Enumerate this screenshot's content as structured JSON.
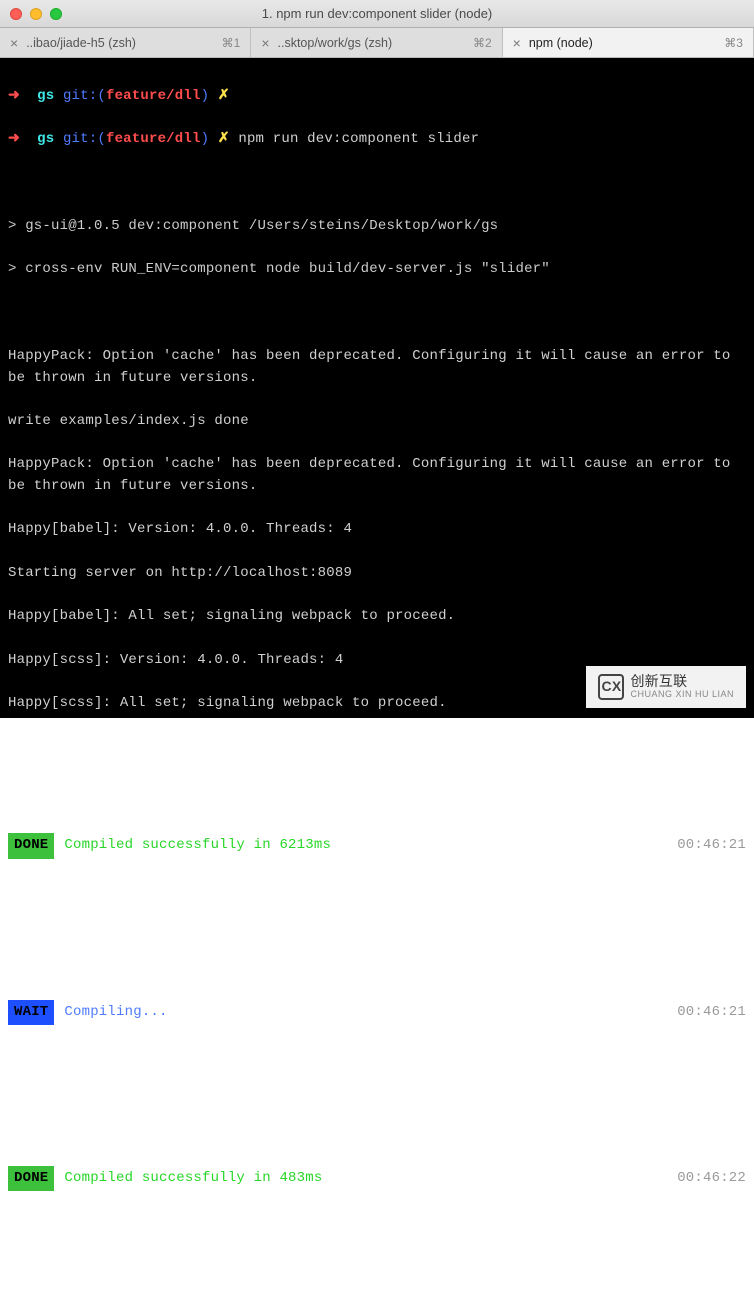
{
  "window": {
    "title": "1. npm run dev:component slider (node)"
  },
  "tabs": [
    {
      "label": "..ibao/jiade-h5 (zsh)",
      "shortcut": "⌘1",
      "active": false
    },
    {
      "label": "..sktop/work/gs (zsh)",
      "shortcut": "⌘2",
      "active": false
    },
    {
      "label": "npm (node)",
      "shortcut": "⌘3",
      "active": true
    }
  ],
  "prompt": {
    "arrow": "➜",
    "dir": "gs",
    "git_prefix": "git:(",
    "branch": "feature/dll",
    "git_suffix": ")",
    "dirty": "✗",
    "command": "npm run dev:component slider"
  },
  "output": {
    "line1": "> gs-ui@1.0.5 dev:component /Users/steins/Desktop/work/gs",
    "line2": "> cross-env RUN_ENV=component node build/dev-server.js \"slider\"",
    "hp1": "HappyPack: Option 'cache' has been deprecated. Configuring it will cause an error to be thrown in future versions.",
    "write": "write examples/index.js done",
    "hp2": "HappyPack: Option 'cache' has been deprecated. Configuring it will cause an error to be thrown in future versions.",
    "babel_ver": "Happy[babel]: Version: 4.0.0. Threads: 4",
    "server": "Starting server on http://localhost:8089",
    "babel_set": "Happy[babel]: All set; signaling webpack to proceed.",
    "scss_ver": "Happy[scss]: Version: 4.0.0. Threads: 4",
    "scss_set": "Happy[scss]: All set; signaling webpack to proceed."
  },
  "status": [
    {
      "badge": "DONE",
      "type": "done",
      "msg": "Compiled successfully in 6213ms",
      "time": "00:46:21"
    },
    {
      "badge": "WAIT",
      "type": "wait",
      "msg": "Compiling...",
      "time": "00:46:21"
    },
    {
      "badge": "DONE",
      "type": "done",
      "msg": "Compiled successfully in 483ms",
      "time": "00:46:22"
    }
  ],
  "watermark": {
    "logo": "CX",
    "text": "创新互联",
    "sub": "CHUANG XIN HU LIAN"
  }
}
